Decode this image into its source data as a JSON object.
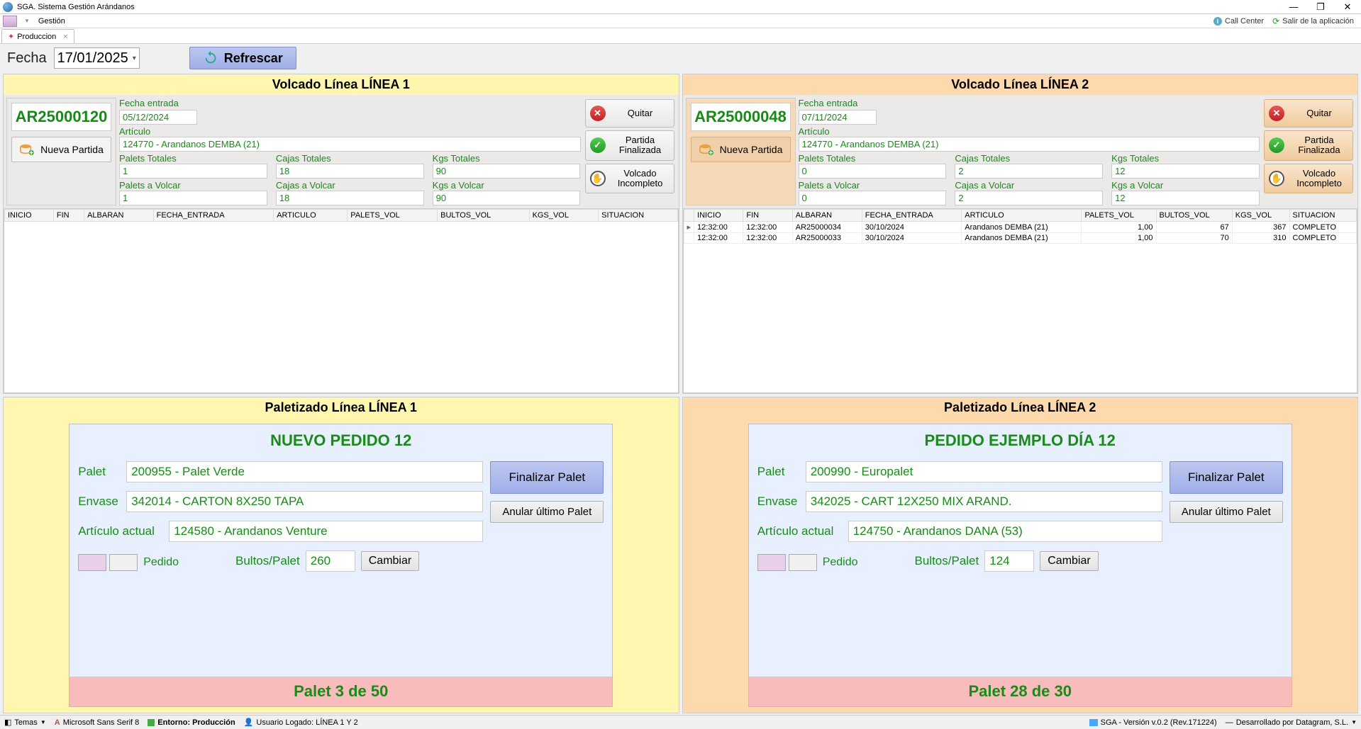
{
  "app_title": "SGA. Sistema Gestión Arándanos",
  "menu": {
    "gestion": "Gestión",
    "callcenter": "Call Center",
    "salir": "Salir de la aplicación"
  },
  "tab": {
    "label": "Produccion"
  },
  "toolbar": {
    "fecha_label": "Fecha",
    "fecha_value": "17/01/2025",
    "refrescar": "Refrescar"
  },
  "linea1": {
    "volcado_title": "Volcado Línea LÍNEA 1",
    "id": "AR25000120",
    "nueva_partida": "Nueva Partida",
    "fecha_entrada_label": "Fecha entrada",
    "fecha_entrada": "05/12/2024",
    "articulo_label": "Artículo",
    "articulo": "124770 - Arandanos DEMBA (21)",
    "palets_totales_label": "Palets Totales",
    "palets_totales": "1",
    "cajas_totales_label": "Cajas Totales",
    "cajas_totales": "18",
    "kgs_totales_label": "Kgs Totales",
    "kgs_totales": "90",
    "palets_volcar_label": "Palets a Volcar",
    "palets_volcar": "1",
    "cajas_volcar_label": "Cajas a Volcar",
    "cajas_volcar": "18",
    "kgs_volcar_label": "Kgs a Volcar",
    "kgs_volcar": "90",
    "btn_quitar": "Quitar",
    "btn_partida_fin": "Partida Finalizada",
    "btn_volcado_inc": "Volcado Incompleto",
    "paletizado_title": "Paletizado Línea LÍNEA 1",
    "pedido_title": "NUEVO PEDIDO 12",
    "palet_label": "Palet",
    "palet": "200955 - Palet Verde",
    "envase_label": "Envase",
    "envase": "342014 - CARTON 8X250 TAPA",
    "articulo_actual_label": "Artículo actual",
    "articulo_actual": "124580 - Arandanos Venture",
    "pedido_label": "Pedido",
    "bultos_label": "Bultos/Palet",
    "bultos": "260",
    "btn_finalizar": "Finalizar Palet",
    "btn_anular": "Anular último Palet",
    "btn_cambiar": "Cambiar",
    "footer": "Palet 3 de 50"
  },
  "linea2": {
    "volcado_title": "Volcado Línea LÍNEA 2",
    "id": "AR25000048",
    "nueva_partida": "Nueva Partida",
    "fecha_entrada_label": "Fecha entrada",
    "fecha_entrada": "07/11/2024",
    "articulo_label": "Artículo",
    "articulo": "124770 - Arandanos DEMBA (21)",
    "palets_totales_label": "Palets Totales",
    "palets_totales": "0",
    "cajas_totales_label": "Cajas Totales",
    "cajas_totales": "2",
    "kgs_totales_label": "Kgs Totales",
    "kgs_totales": "12",
    "palets_volcar_label": "Palets a Volcar",
    "palets_volcar": "0",
    "cajas_volcar_label": "Cajas a Volcar",
    "cajas_volcar": "2",
    "kgs_volcar_label": "Kgs a Volcar",
    "kgs_volcar": "12",
    "btn_quitar": "Quitar",
    "btn_partida_fin": "Partida Finalizada",
    "btn_volcado_inc": "Volcado Incompleto",
    "paletizado_title": "Paletizado Línea LÍNEA 2",
    "pedido_title": "PEDIDO EJEMPLO DÍA 12",
    "palet_label": "Palet",
    "palet": "200990 - Europalet",
    "envase_label": "Envase",
    "envase": "342025 - CART   12X250 MIX ARAND.",
    "articulo_actual_label": "Artículo actual",
    "articulo_actual": "124750 - Arandanos DANA (53)",
    "pedido_label": "Pedido",
    "bultos_label": "Bultos/Palet",
    "bultos": "124",
    "btn_finalizar": "Finalizar Palet",
    "btn_anular": "Anular último Palet",
    "btn_cambiar": "Cambiar",
    "footer": "Palet 28 de 30"
  },
  "cols": {
    "inicio": "INICIO",
    "fin": "FIN",
    "albaran": "ALBARAN",
    "fecha_entrada": "FECHA_ENTRADA",
    "articulo": "ARTICULO",
    "palets_vol": "PALETS_VOL",
    "bultos_vol": "BULTOS_VOL",
    "kgs_vol": "KGS_VOL",
    "situacion": "SITUACION"
  },
  "linea2_rows": [
    {
      "inicio": "12:32:00",
      "fin": "12:32:00",
      "albaran": "AR25000034",
      "fecha": "30/10/2024",
      "articulo": "Arandanos DEMBA (21)",
      "palets": "1,00",
      "bultos": "67",
      "kgs": "367",
      "sit": "COMPLETO"
    },
    {
      "inicio": "12:32:00",
      "fin": "12:32:00",
      "albaran": "AR25000033",
      "fecha": "30/10/2024",
      "articulo": "Arandanos DEMBA (21)",
      "palets": "1,00",
      "bultos": "70",
      "kgs": "310",
      "sit": "COMPLETO"
    }
  ],
  "status": {
    "temas": "Temas",
    "font": "Microsoft Sans Serif 8",
    "entorno": "Entorno: Producción",
    "usuario": "Usuario Logado: LÍNEA 1 Y 2",
    "version": "SGA - Versión v.0.2 (Rev.171224)",
    "dev": "Desarrollado por Datagram, S.L."
  }
}
